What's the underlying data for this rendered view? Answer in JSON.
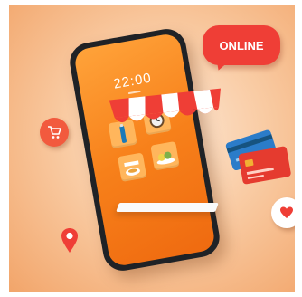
{
  "scene": {
    "phone_time": "22:00",
    "bubble_text": "ONLINE"
  },
  "icons": {
    "cart": "shopping-cart-icon",
    "heart": "heart-icon",
    "pin": "location-pin-icon",
    "cards": "credit-cards-icon"
  },
  "colors": {
    "orange": "#f7801a",
    "red": "#ef3e36",
    "awning_white": "#ffffff",
    "card_blue": "#2b7cc9",
    "card_red": "#e53b2f",
    "card_gold": "#f2b133"
  }
}
